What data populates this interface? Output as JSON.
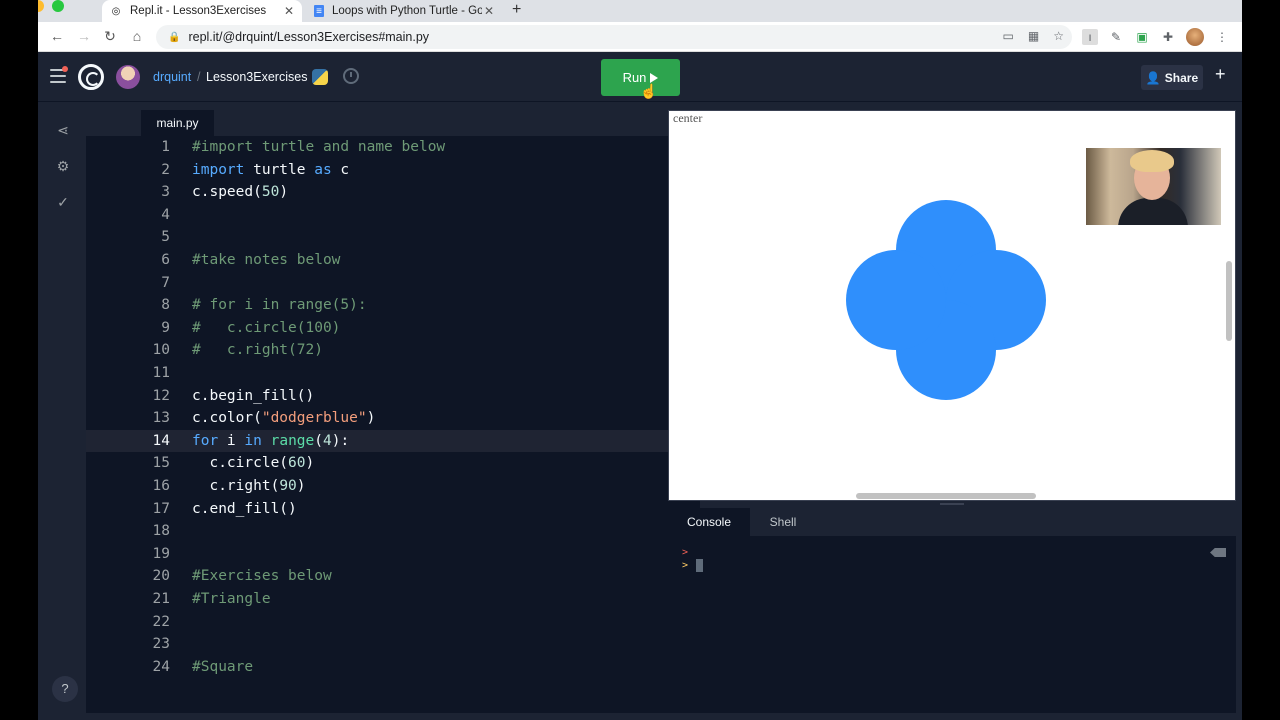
{
  "browser": {
    "tabs": [
      {
        "title": "Repl.it - Lesson3Exercises",
        "close": "✕"
      },
      {
        "title": "Loops with Python Turtle - Goo",
        "close": "✕"
      }
    ],
    "new_tab": "+",
    "url": "repl.it/@drquint/Lesson3Exercises#main.py"
  },
  "header": {
    "user": "drquint",
    "separator": "/",
    "repl_name": "Lesson3Exercises",
    "run_label": "Run",
    "share_label": "Share",
    "add_label": "+"
  },
  "sidebar": {
    "help": "?"
  },
  "editor": {
    "file_tab": "main.py",
    "active_line": 14,
    "lines": [
      {
        "n": "1",
        "text": "#import turtle and name below"
      },
      {
        "n": "2",
        "text": "import turtle as c"
      },
      {
        "n": "3",
        "text": "c.speed(50)"
      },
      {
        "n": "4",
        "text": ""
      },
      {
        "n": "5",
        "text": ""
      },
      {
        "n": "6",
        "text": "#take notes below"
      },
      {
        "n": "7",
        "text": ""
      },
      {
        "n": "8",
        "text": "# for i in range(5):"
      },
      {
        "n": "9",
        "text": "#   c.circle(100)"
      },
      {
        "n": "10",
        "text": "#   c.right(72)"
      },
      {
        "n": "11",
        "text": ""
      },
      {
        "n": "12",
        "text": "c.begin_fill()"
      },
      {
        "n": "13",
        "text": "c.color(\"dodgerblue\")"
      },
      {
        "n": "14",
        "text": "for i in range(4):"
      },
      {
        "n": "15",
        "text": "  c.circle(60)"
      },
      {
        "n": "16",
        "text": "  c.right(90)"
      },
      {
        "n": "17",
        "text": "c.end_fill()"
      },
      {
        "n": "18",
        "text": ""
      },
      {
        "n": "19",
        "text": ""
      },
      {
        "n": "20",
        "text": "#Exercises below"
      },
      {
        "n": "21",
        "text": "#Triangle"
      },
      {
        "n": "22",
        "text": ""
      },
      {
        "n": "23",
        "text": ""
      },
      {
        "n": "24",
        "text": "#Square"
      }
    ]
  },
  "output": {
    "canvas_label": "center",
    "shape_color": "#2f8ffc"
  },
  "console": {
    "tabs": [
      "Console",
      "Shell"
    ],
    "prompt_1": ">",
    "prompt_2": ">"
  },
  "colors": {
    "run_button": "#2da44e",
    "accent_link": "#57abff"
  }
}
